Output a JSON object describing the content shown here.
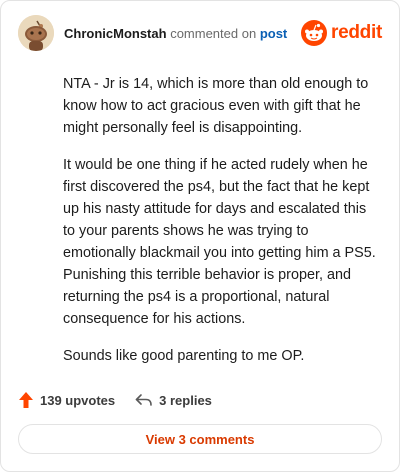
{
  "comment": {
    "author": "ChronicMonstah",
    "action_text": "commented on",
    "post_link": "post",
    "paragraphs": [
      "NTA - Jr is 14, which is more than old enough to know how to act gracious even with gift that he might personally feel is disappointing.",
      "It would be one thing if he acted rudely when he first discovered the ps4, but the fact that he kept up his nasty attitude for days and escalated this to your parents shows he was trying to emotionally blackmail you into getting him a PS5. Punishing this terrible behavior is proper, and returning the ps4 is a proportional, natural consequence for his actions.",
      "Sounds like good parenting to me OP."
    ]
  },
  "brand": {
    "name": "reddit",
    "icon": "reddit-logo-icon",
    "color": "#ff4500"
  },
  "actions": {
    "upvotes": "139 upvotes",
    "replies": "3 replies",
    "upvote_icon": "upvote-arrow-icon",
    "reply_icon": "reply-arrow-icon",
    "upvote_color": "#ff4500"
  },
  "view_comments": "View 3 comments",
  "colors": {
    "link": "#0a5fb4",
    "accent_text": "#d93a00"
  }
}
